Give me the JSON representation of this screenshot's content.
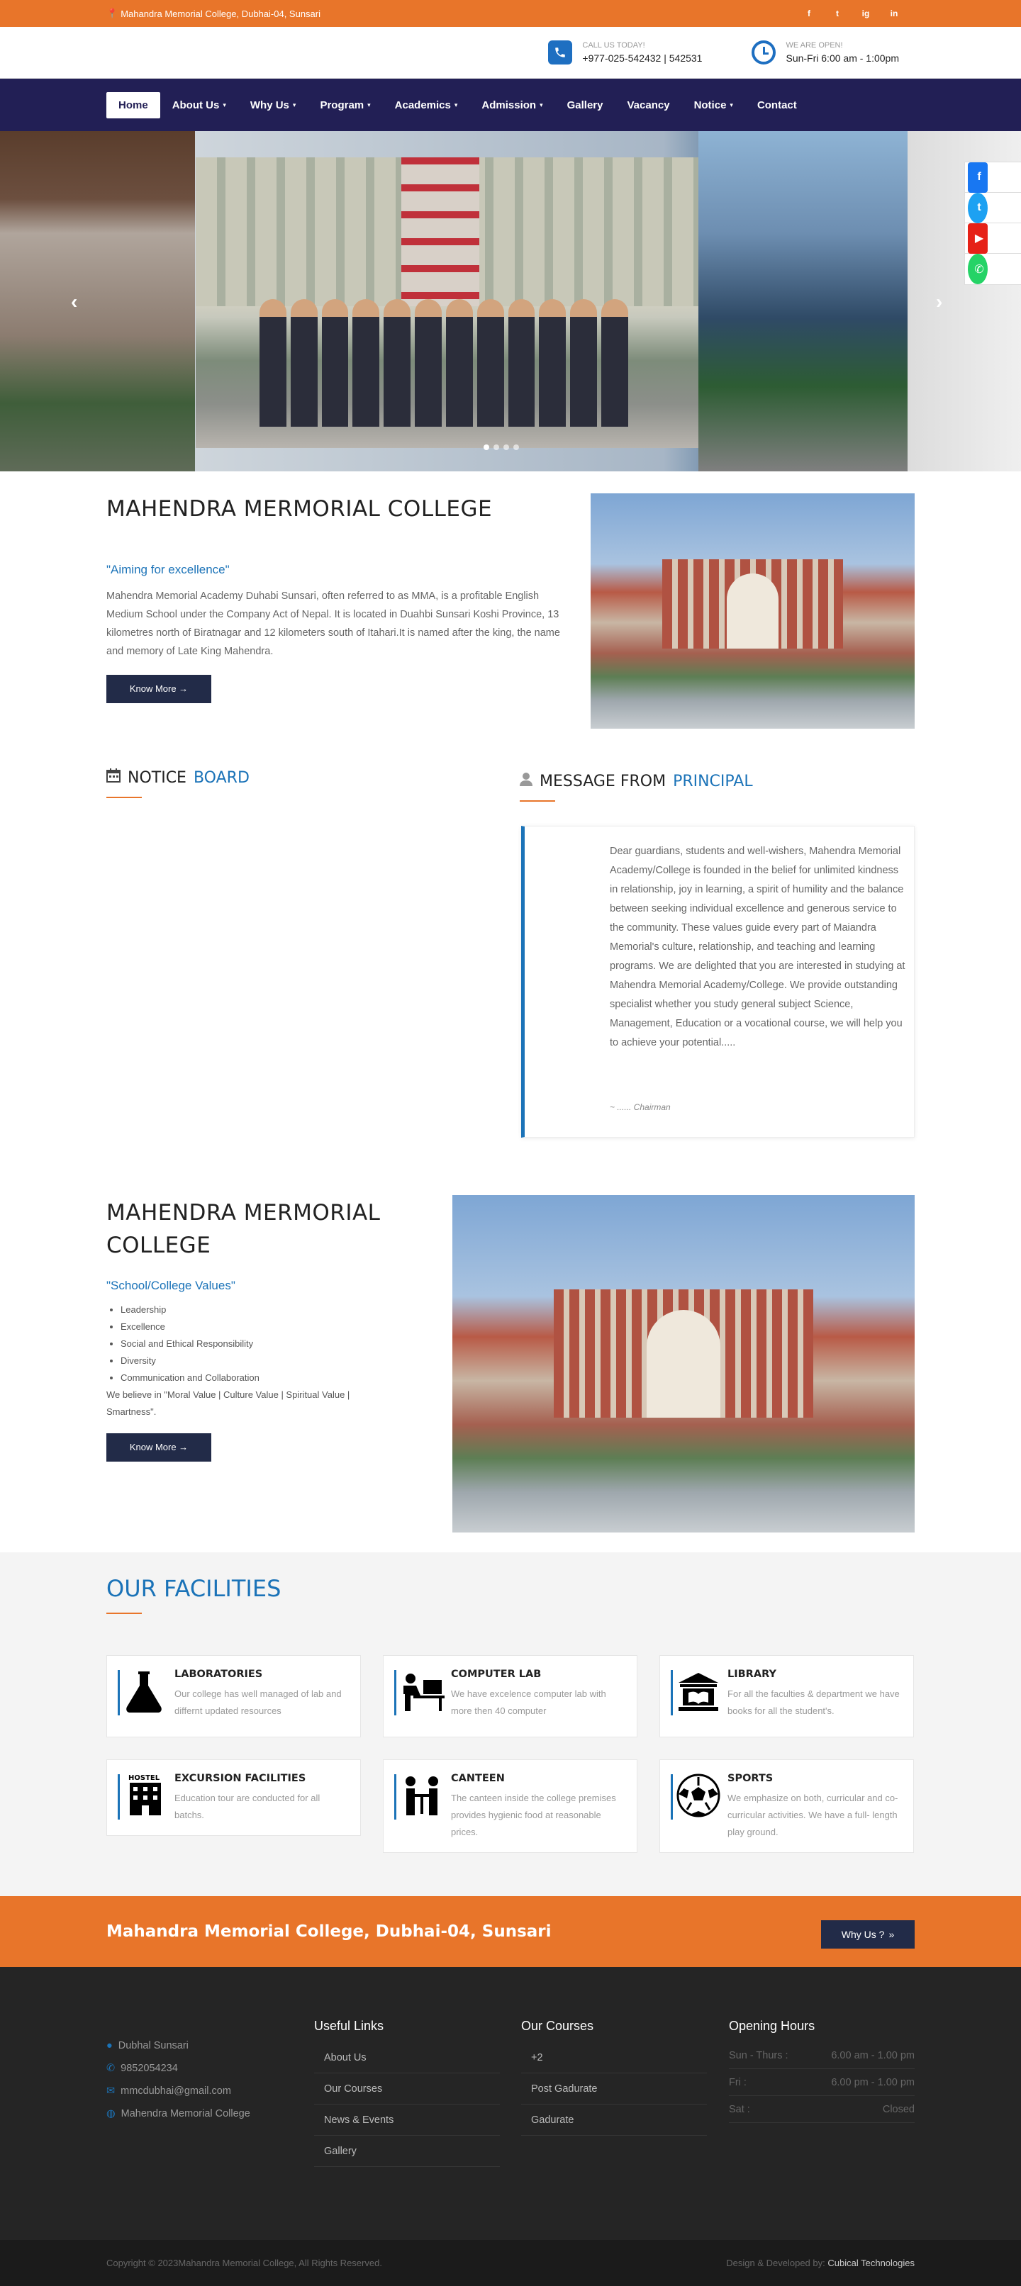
{
  "topbar": {
    "address": "Mahandra Memorial College, Dubhai-04, Sunsari",
    "social": [
      "f",
      "t",
      "ig",
      "in"
    ]
  },
  "contact": {
    "call_label": "CALL US TODAY!",
    "call_value": "+977-025-542432 | 542531",
    "open_label": "WE ARE OPEN!",
    "open_value": "Sun-Fri 6:00 am - 1:00pm"
  },
  "nav": {
    "items": [
      {
        "label": "Home",
        "caret": false
      },
      {
        "label": "About Us",
        "caret": true
      },
      {
        "label": "Why Us",
        "caret": true
      },
      {
        "label": "Program",
        "caret": true
      },
      {
        "label": "Academics",
        "caret": true
      },
      {
        "label": "Admission",
        "caret": true
      },
      {
        "label": "Gallery",
        "caret": false
      },
      {
        "label": "Vacancy",
        "caret": false
      },
      {
        "label": "Notice",
        "caret": true
      },
      {
        "label": "Contact",
        "caret": false
      }
    ]
  },
  "hero": {
    "slides": 4,
    "active_slide": 1
  },
  "about": {
    "title": "MAHENDRA MERMORIAL COLLEGE",
    "tagline": "\"Aiming for excellence\"",
    "text": "Mahendra Memorial Academy Duhabi Sunsari, often referred to as MMA, is a profitable English Medium School under the Company Act of Nepal. It is located in Duahbi Sunsari Koshi Province, 13 kilometres north of Biratnagar and 12 kilometers south of Itahari.It is named after the king, the name and memory of Late King Mahendra.",
    "button": "Know More →"
  },
  "notice": {
    "title_a": "NOTICE",
    "title_b": "BOARD"
  },
  "message": {
    "title_a": "MESSAGE FROM",
    "title_b": "PRINCIPAL",
    "text": "Dear guardians, students and well-wishers, Mahendra Memorial Academy/College is founded in the belief for unlimited kindness in relationship, joy in learning, a spirit of humility and the balance between seeking individual excellence and generous service to the community. These values guide every part of Maiandra Memorial's culture, relationship, and teaching and learning programs. We are delighted that you are interested in studying at Mahendra Memorial Academy/College. We provide outstanding specialist whether you study general subject Science, Management, Education or a vocational course, we will help you to achieve your potential.....",
    "sign": "~ ...... Chairman"
  },
  "values": {
    "title": "MAHENDRA MERMORIAL COLLEGE",
    "tagline": "\"School/College Values\"",
    "items": [
      "Leadership",
      "Excellence",
      "Social and Ethical Responsibility",
      "Diversity",
      "Communication and Collaboration"
    ],
    "note": "We believe in \"Moral Value | Culture Value | Spiritual Value | Smartness\".",
    "button": "Know More →"
  },
  "facilities": {
    "title": "OUR FACILITIES",
    "items": [
      {
        "title": "LABORATORIES",
        "desc": "Our college has well managed of lab and differnt updated resources",
        "icon": "flask-icon"
      },
      {
        "title": "COMPUTER LAB",
        "desc": "We have excelence computer lab with more then 40 computer",
        "icon": "computer-desk-icon"
      },
      {
        "title": "LIBRARY",
        "desc": "For all the faculties & department we have books for all the student's.",
        "icon": "library-icon"
      },
      {
        "title": "EXCURSION FACILITIES",
        "desc": "Education tour are conducted for all batchs.",
        "icon": "hostel-icon"
      },
      {
        "title": "CANTEEN",
        "desc": "The canteen inside the college premises provides hygienic food at reasonable prices.",
        "icon": "canteen-icon"
      },
      {
        "title": "SPORTS",
        "desc": "We emphasize on both, curricular and co- curricular activities. We have a full- length play ground.",
        "icon": "soccer-ball-icon"
      }
    ]
  },
  "banner": {
    "title": "Mahandra Memorial College, Dubhai-04, Sunsari",
    "button": "Why Us ?"
  },
  "footer": {
    "contact": [
      "Dubhal Sunsari",
      "9852054234",
      "mmcdubhai@gmail.com",
      "Mahendra Memorial College"
    ],
    "useful_title": "Useful Links",
    "useful": [
      "About Us",
      "Our Courses",
      "News & Events",
      "Gallery"
    ],
    "courses_title": "Our Courses",
    "courses": [
      "+2",
      "Post Gadurate",
      "Gadurate"
    ],
    "hours_title": "Opening Hours",
    "hours": [
      {
        "day": "Sun - Thurs :",
        "time": "6.00 am - 1.00 pm"
      },
      {
        "day": "Fri :",
        "time": "6.00 pm - 1.00 pm"
      },
      {
        "day": "Sat :",
        "time": "Closed"
      }
    ]
  },
  "copyright": {
    "left": "Copyright © 2023Mahandra Memorial College, All Rights Reserved.",
    "right_prefix": "Design & Developed by:",
    "right_link": "Cubical Technologies"
  },
  "colors": {
    "orange": "#e8752a",
    "navy": "#221f55",
    "blue": "#1b73b8"
  }
}
